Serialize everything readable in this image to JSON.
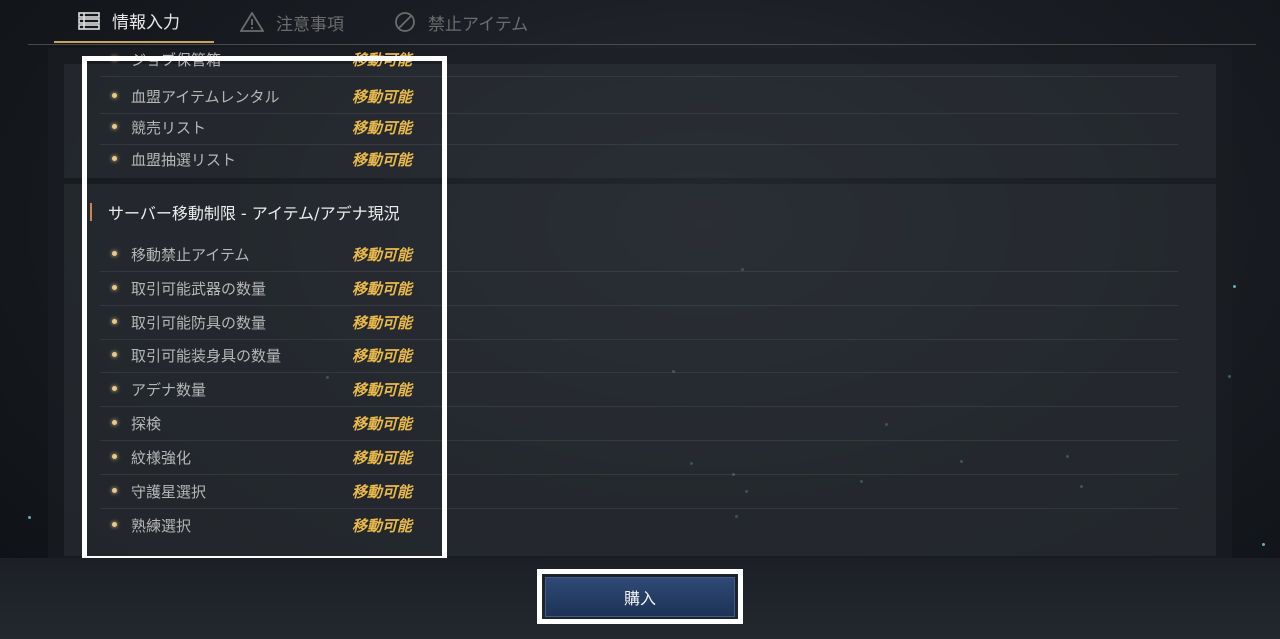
{
  "tabs": [
    {
      "label": "情報入力",
      "icon": "list-icon",
      "active": true
    },
    {
      "label": "注意事項",
      "icon": "warning-icon",
      "active": false
    },
    {
      "label": "禁止アイテム",
      "icon": "prohibited-icon",
      "active": false
    }
  ],
  "card1": {
    "rows": [
      {
        "label": "ジョブ保管箱",
        "value": "移動可能"
      },
      {
        "label": "血盟アイテムレンタル",
        "value": "移動可能"
      },
      {
        "label": "競売リスト",
        "value": "移動可能"
      },
      {
        "label": "血盟抽選リスト",
        "value": "移動可能"
      }
    ]
  },
  "card2": {
    "title": "サーバー移動制限 - アイテム/アデナ現況",
    "rows": [
      {
        "label": "移動禁止アイテム",
        "value": "移動可能"
      },
      {
        "label": "取引可能武器の数量",
        "value": "移動可能"
      },
      {
        "label": "取引可能防具の数量",
        "value": "移動可能"
      },
      {
        "label": "取引可能装身具の数量",
        "value": "移動可能"
      },
      {
        "label": "アデナ数量",
        "value": "移動可能"
      },
      {
        "label": "探検",
        "value": "移動可能"
      },
      {
        "label": "紋様強化",
        "value": "移動可能"
      },
      {
        "label": "守護星選択",
        "value": "移動可能"
      },
      {
        "label": "熟練選択",
        "value": "移動可能"
      }
    ]
  },
  "footer": {
    "buy_label": "購入"
  },
  "colors": {
    "accent_gold": "#e9b94a",
    "tab_underline": "#c9a461",
    "button_blue": "#2f4a75",
    "section_bar": "#c9874c"
  }
}
